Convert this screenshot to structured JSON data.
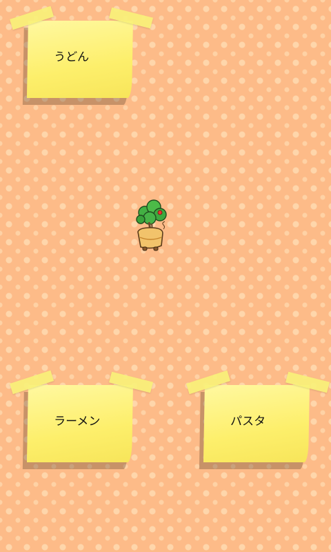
{
  "notes": [
    {
      "id": "udon",
      "label": "うどん"
    },
    {
      "id": "ramen",
      "label": "ラーメン"
    },
    {
      "id": "pasta",
      "label": "パスタ"
    }
  ],
  "character": {
    "icon": "potted-tree-character-icon"
  },
  "colors": {
    "background": "#fdbb88",
    "note": "#fdef6b",
    "tree": "#3aa63a",
    "pot": "#f2c36b"
  }
}
